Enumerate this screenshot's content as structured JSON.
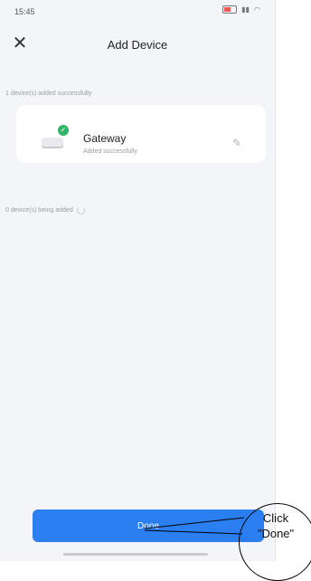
{
  "status_bar": {
    "time": "15:45"
  },
  "header": {
    "title": "Add Device",
    "close_icon": "close-icon"
  },
  "sections": {
    "added_label": "1 device(s) added successfully",
    "adding_label": "0 device(s) being added"
  },
  "device": {
    "name": "Gateway",
    "status": "Added successfully",
    "badge_color": "#2fb565"
  },
  "footer": {
    "done_label": "Done",
    "accent": "#2a7ef0"
  },
  "annotation": {
    "line1": "Click",
    "line2": "\"Done\""
  }
}
